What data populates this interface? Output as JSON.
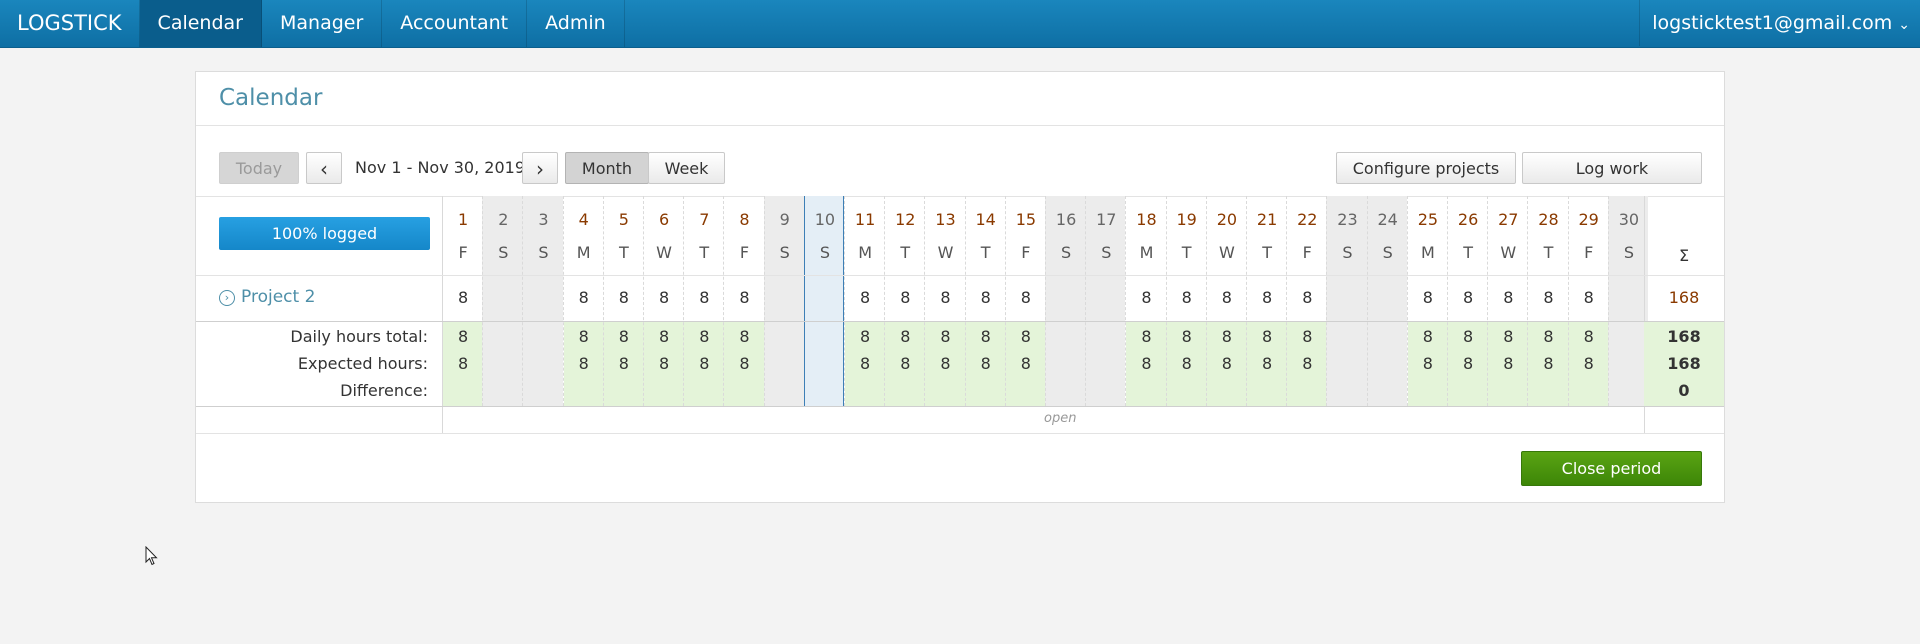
{
  "nav": {
    "brand": "LOGSTICK",
    "items": [
      "Calendar",
      "Manager",
      "Accountant",
      "Admin"
    ],
    "active_index": 0,
    "user": "logsticktest1@gmail.com"
  },
  "panel": {
    "title": "Calendar",
    "today_label": "Today",
    "prev_label": "‹",
    "next_label": "›",
    "date_range": "Nov 1 - Nov 30, 2019",
    "view_month": "Month",
    "view_week": "Week",
    "configure_label": "Configure projects",
    "log_work_label": "Log work",
    "progress_label": "100% logged",
    "progress_fraction": 1.0,
    "close_period_label": "Close period",
    "open_label": "open"
  },
  "calendar": {
    "days": [
      {
        "n": "1",
        "d": "F",
        "type": "work"
      },
      {
        "n": "2",
        "d": "S",
        "type": "weekend"
      },
      {
        "n": "3",
        "d": "S",
        "type": "weekend"
      },
      {
        "n": "4",
        "d": "M",
        "type": "work"
      },
      {
        "n": "5",
        "d": "T",
        "type": "work"
      },
      {
        "n": "6",
        "d": "W",
        "type": "work"
      },
      {
        "n": "7",
        "d": "T",
        "type": "work"
      },
      {
        "n": "8",
        "d": "F",
        "type": "work"
      },
      {
        "n": "9",
        "d": "S",
        "type": "weekend"
      },
      {
        "n": "10",
        "d": "S",
        "type": "today"
      },
      {
        "n": "11",
        "d": "M",
        "type": "work"
      },
      {
        "n": "12",
        "d": "T",
        "type": "work"
      },
      {
        "n": "13",
        "d": "W",
        "type": "work"
      },
      {
        "n": "14",
        "d": "T",
        "type": "work"
      },
      {
        "n": "15",
        "d": "F",
        "type": "work"
      },
      {
        "n": "16",
        "d": "S",
        "type": "weekend"
      },
      {
        "n": "17",
        "d": "S",
        "type": "weekend"
      },
      {
        "n": "18",
        "d": "M",
        "type": "work"
      },
      {
        "n": "19",
        "d": "T",
        "type": "work"
      },
      {
        "n": "20",
        "d": "W",
        "type": "work"
      },
      {
        "n": "21",
        "d": "T",
        "type": "work"
      },
      {
        "n": "22",
        "d": "F",
        "type": "work"
      },
      {
        "n": "23",
        "d": "S",
        "type": "weekend"
      },
      {
        "n": "24",
        "d": "S",
        "type": "weekend"
      },
      {
        "n": "25",
        "d": "M",
        "type": "work"
      },
      {
        "n": "26",
        "d": "T",
        "type": "work"
      },
      {
        "n": "27",
        "d": "W",
        "type": "work"
      },
      {
        "n": "28",
        "d": "T",
        "type": "work"
      },
      {
        "n": "29",
        "d": "F",
        "type": "work"
      },
      {
        "n": "30",
        "d": "S",
        "type": "weekend"
      }
    ],
    "sigma": "Σ",
    "project": {
      "name": "Project 2",
      "work_day_hours": "8",
      "total": "168"
    },
    "summary": {
      "daily_label": "Daily hours total:",
      "expected_label": "Expected hours:",
      "difference_label": "Difference:",
      "daily_value": "8",
      "expected_value": "8",
      "daily_total": "168",
      "expected_total": "168",
      "difference_total": "0"
    }
  },
  "colors": {
    "nav": "#1479b0",
    "accent": "#4e8fa8",
    "green": "#4a9a0d",
    "progress": "#1e93d6"
  }
}
